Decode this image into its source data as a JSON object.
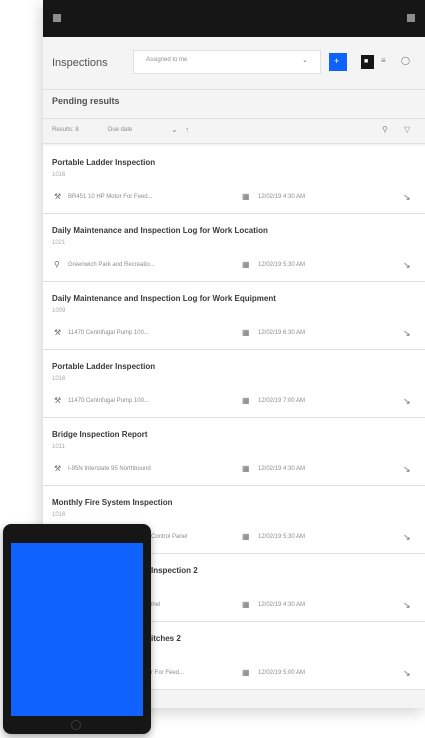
{
  "header": {
    "title": "Inspections",
    "assigned_filter": "Assigned to me",
    "add_label": "+",
    "view_label": "■"
  },
  "section": {
    "title": "Pending results"
  },
  "filterbar": {
    "results_label": "Results: 8",
    "sort_value": "Due date"
  },
  "items": [
    {
      "name": "Portable Ladder Inspection",
      "code": "1016",
      "asset": "BR451 10 HP Motor For Feed...",
      "date": "12/02/19 4:30 AM",
      "asset_icon": "wrench-icon"
    },
    {
      "name": "Daily Maintenance and Inspection Log for Work Location",
      "code": "1021",
      "asset": "Greenwich Park and Recreatio...",
      "date": "12/02/19 5:30 AM",
      "asset_icon": "location-icon"
    },
    {
      "name": "Daily Maintenance and Inspection Log for Work Equipment",
      "code": "1009",
      "asset": "11470 Centrifugal Pump 100...",
      "date": "12/02/19 6:30 AM",
      "asset_icon": "wrench-icon"
    },
    {
      "name": "Portable Ladder Inspection",
      "code": "1016",
      "asset": "11470 Centrifugal Pump 100...",
      "date": "12/02/19 7:00 AM",
      "asset_icon": "wrench-icon"
    },
    {
      "name": "Bridge Inspection Report",
      "code": "1011",
      "asset": "I-95N Interstate 95 Northbound",
      "date": "12/02/19 4:30 AM",
      "asset_icon": "wrench-icon"
    },
    {
      "name": "Monthly Fire System Inspection",
      "code": "1016",
      "asset": "Control Panel",
      "date": "12/02/19 5:30 AM",
      "asset_icon": "wrench-icon"
    },
    {
      "name": "Inspection 2",
      "code": "",
      "asset": "ihel",
      "date": "12/02/19 4:30 AM",
      "asset_icon": "wrench-icon"
    },
    {
      "name": "itches 2",
      "code": "",
      "asset": "r For Feed...",
      "date": "12/02/19 5:00 AM",
      "asset_icon": "wrench-icon"
    }
  ]
}
